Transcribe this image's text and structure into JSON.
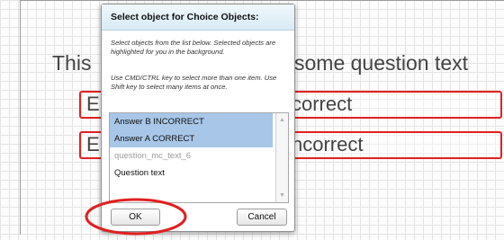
{
  "canvas": {
    "question_left": "This",
    "question_right": "some question text",
    "answers": [
      {
        "left": "E",
        "right": "correct"
      },
      {
        "left": "E",
        "right": "ncorrect"
      }
    ]
  },
  "dialog": {
    "title": "Select object for Choice Objects:",
    "note1": "Select objects from the list below. Selected objects are highlighted for you in the background.",
    "note2": "Use CMD/CTRL key to select more than one item. Use Shift key to select many items at once.",
    "list": [
      {
        "label": "Answer B INCORRECT",
        "selected": true
      },
      {
        "label": "Answer A CORRECT",
        "selected": true
      },
      {
        "label": "question_mc_text_6",
        "selected": false
      },
      {
        "label": "Question text",
        "selected": false
      }
    ],
    "ok_label": "OK",
    "cancel_label": "Cancel"
  },
  "colors": {
    "highlight": "#e02020",
    "selection": "#a8c6e8"
  }
}
